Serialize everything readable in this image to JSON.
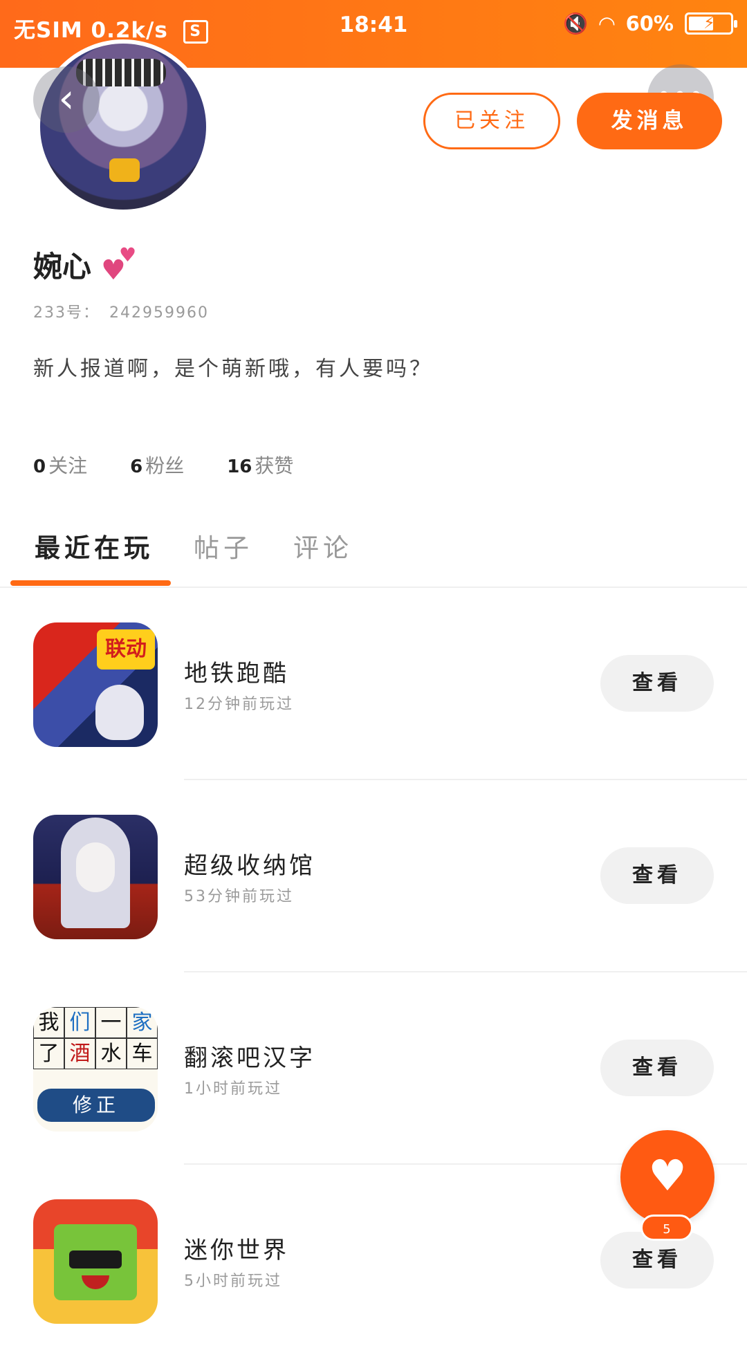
{
  "status_bar": {
    "carrier": "无SIM",
    "speed": "0.2k/s",
    "sim_icon": "S",
    "time": "18:41",
    "battery": "60%",
    "battery_level": 0.6
  },
  "header": {
    "follow_label": "已关注",
    "message_label": "发消息",
    "back_icon": "chevron-left-icon",
    "more_icon": "more-dots-icon"
  },
  "profile": {
    "name": "婉心",
    "id_label": "233号：",
    "id_value": "242959960",
    "bio": "新人报道啊，是个萌新哦，有人要吗？",
    "stats": [
      {
        "count": "0",
        "label": "关注"
      },
      {
        "count": "6",
        "label": "粉丝"
      },
      {
        "count": "16",
        "label": "获赞"
      }
    ]
  },
  "tabs": [
    {
      "label": "最近在玩",
      "active": true
    },
    {
      "label": "帖子",
      "active": false
    },
    {
      "label": "评论",
      "active": false
    }
  ],
  "games": [
    {
      "title": "地铁跑酷",
      "time": "12分钟前玩过",
      "button": "查看",
      "icon_text": "联动"
    },
    {
      "title": "超级收纳馆",
      "time": "53分钟前玩过",
      "button": "查看"
    },
    {
      "title": "翻滚吧汉字",
      "time": "1小时前玩过",
      "button": "查看",
      "icon_grid": [
        "我",
        "们",
        "一",
        "家",
        "了",
        "酒",
        "水",
        "车"
      ],
      "icon_banner": "修正"
    },
    {
      "title": "迷你世界",
      "time": "5小时前玩过",
      "button": "查看"
    }
  ],
  "fab": {
    "icon": "heart-icon",
    "badge": "5"
  },
  "colors": {
    "accent": "#ff6a14",
    "status_bar": "#ff7a14"
  }
}
